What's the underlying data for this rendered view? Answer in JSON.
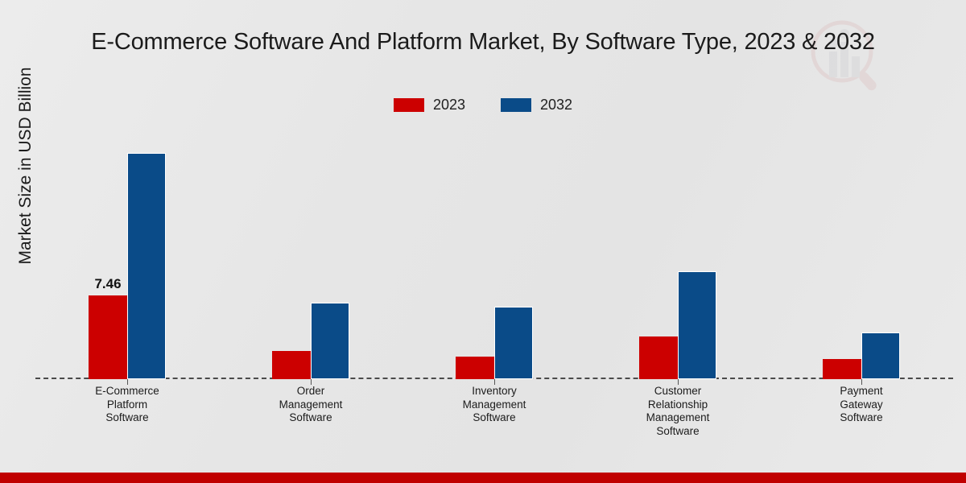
{
  "chart_data": {
    "type": "bar",
    "title": "E-Commerce Software And Platform Market, By Software Type, 2023 & 2032",
    "xlabel": "",
    "ylabel": "Market Size in USD Billion",
    "grid": false,
    "legend_position": "top-center",
    "ylim": [
      0,
      22
    ],
    "categories": [
      "E-Commerce Platform Software",
      "Order Management Software",
      "Inventory Management Software",
      "Customer Relationship Management Software",
      "Payment Gateway Software"
    ],
    "category_lines": [
      [
        "E-Commerce",
        "Platform",
        "Software"
      ],
      [
        "Order",
        "Management",
        "Software"
      ],
      [
        "Inventory",
        "Management",
        "Software"
      ],
      [
        "Customer",
        "Relationship",
        "Management",
        "Software"
      ],
      [
        "Payment",
        "Gateway",
        "Software"
      ]
    ],
    "series": [
      {
        "name": "2023",
        "color": "#cc0000",
        "values": [
          7.46,
          2.5,
          2.0,
          3.8,
          1.8
        ],
        "labels": [
          "7.46",
          "",
          "",
          "",
          ""
        ]
      },
      {
        "name": "2032",
        "color": "#0a4b88",
        "values": [
          20.2,
          6.8,
          6.5,
          9.6,
          4.2
        ],
        "labels": [
          "",
          "",
          "",
          "",
          ""
        ]
      }
    ],
    "annotations": [
      {
        "text": "7.46",
        "series": "2023",
        "category": "E-Commerce Platform Software"
      }
    ]
  },
  "colors": {
    "series_2023": "#cc0000",
    "series_2032": "#0a4b88",
    "background": "#e8e8e8",
    "bottom_band": "#c00000",
    "axis": "#4a4a4a",
    "text": "#1b1b1b"
  },
  "legend": {
    "items": [
      {
        "label": "2023",
        "color": "#cc0000"
      },
      {
        "label": "2032",
        "color": "#0a4b88"
      }
    ]
  },
  "watermark": {
    "name": "magnifier-bar-chart-logo"
  }
}
